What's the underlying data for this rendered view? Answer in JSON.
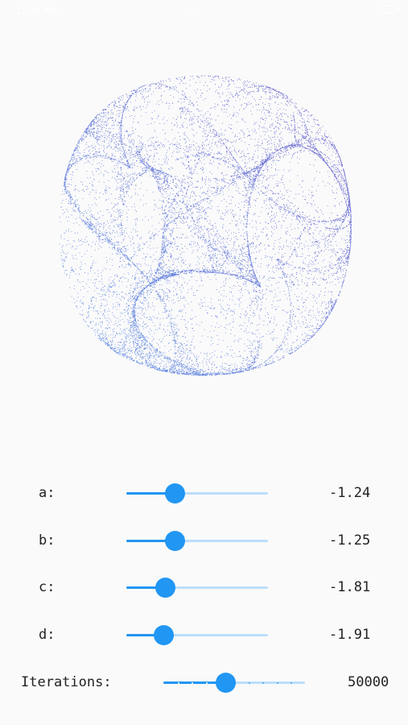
{
  "status_bar": {
    "left_text": "12:00 AM",
    "center_text": "--:--"
  },
  "attractor": {
    "title": "",
    "color_start": "#2f6fe0",
    "color_end": "#4a3cc0"
  },
  "controls": [
    {
      "label": "a:",
      "value_text": "-1.24",
      "slider_fraction": 0.34
    },
    {
      "label": "b:",
      "value_text": "-1.25",
      "slider_fraction": 0.34
    },
    {
      "label": "c:",
      "value_text": "-1.81",
      "slider_fraction": 0.27
    },
    {
      "label": "d:",
      "value_text": "-1.91",
      "slider_fraction": 0.26
    }
  ],
  "iterations": {
    "label": "Iterations:",
    "value_text": "50000",
    "slider_fraction": 0.44,
    "divisions": 10
  },
  "accent_color": "#2196f3",
  "track_color": "#bbdefb"
}
